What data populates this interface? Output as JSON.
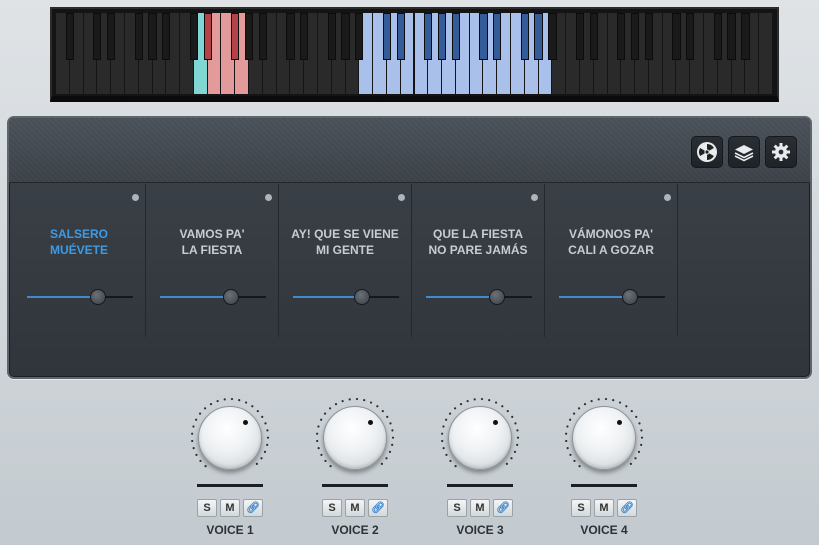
{
  "keyboard": {
    "white_key_count": 52,
    "highlight_ranges": [
      {
        "from": 10,
        "to": 10,
        "color": "#7fd6d2"
      },
      {
        "from": 11,
        "to": 13,
        "color": "#e39a9b"
      },
      {
        "from": 22,
        "to": 35,
        "color": "#a9c0ea"
      }
    ],
    "black_highlight_color_red": "#b34346",
    "black_highlight_color_blue": "#345c98"
  },
  "header": {
    "buttons": [
      {
        "name": "radiation-button",
        "icon": "radiation-icon"
      },
      {
        "name": "layers-button",
        "icon": "layers-icon"
      },
      {
        "name": "settings-button",
        "icon": "gear-icon"
      }
    ]
  },
  "slots": [
    {
      "title": "SALSERO\nMUÉVETE",
      "active": true,
      "level": 0.66
    },
    {
      "title": "VAMOS PA'\nLA FIESTA",
      "active": false,
      "level": 0.66
    },
    {
      "title": "AY! QUE SE VIENE\nMI GENTE",
      "active": false,
      "level": 0.64
    },
    {
      "title": "QUE LA FIESTA\nNO PARE JAMÁS",
      "active": false,
      "level": 0.66
    },
    {
      "title": "VÁMONOS PA'\nCALI A GOZAR",
      "active": false,
      "level": 0.66
    }
  ],
  "voices": [
    {
      "label": "VOICE 1",
      "s": "S",
      "m": "M"
    },
    {
      "label": "VOICE 2",
      "s": "S",
      "m": "M"
    },
    {
      "label": "VOICE 3",
      "s": "S",
      "m": "M"
    },
    {
      "label": "VOICE 4",
      "s": "S",
      "m": "M"
    }
  ],
  "colors": {
    "accent": "#3f89cf",
    "active_text": "#3d9be6"
  }
}
